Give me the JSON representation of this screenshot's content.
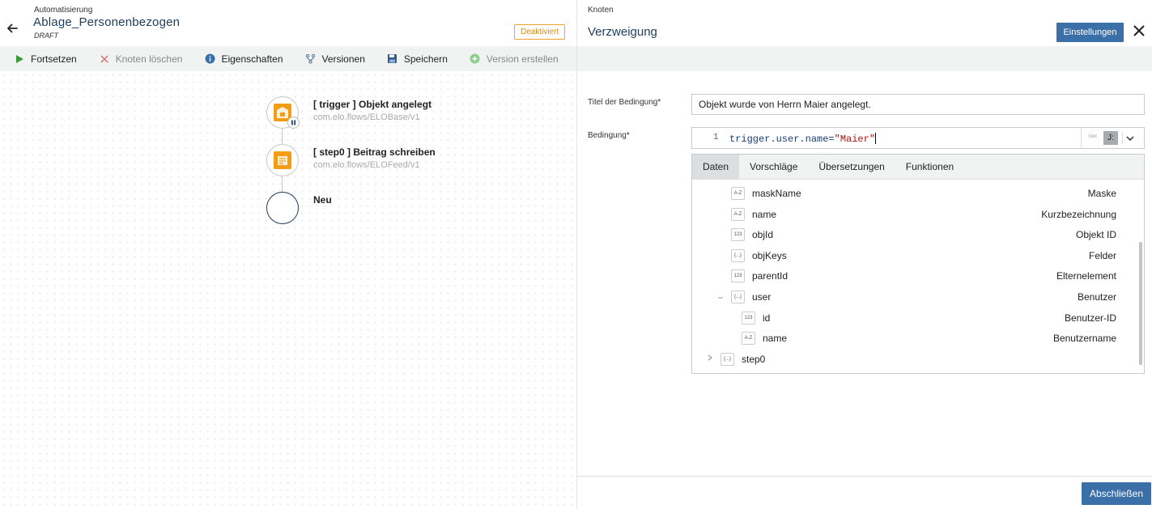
{
  "workflow": {
    "breadcrumb": "Automatisierung",
    "title": "Ablage_Personenbezogen",
    "status": "DRAFT",
    "state_badge": "Deaktiviert"
  },
  "toolbar": {
    "continue": "Fortsetzen",
    "delete_node": "Knoten löschen",
    "properties": "Eigenschaften",
    "versions": "Versionen",
    "save": "Speichern",
    "create_version": "Version erstellen"
  },
  "flow": {
    "nodes": [
      {
        "title": "[ trigger ] Objekt angelegt",
        "subtitle": "com.elo.flows/ELOBase/v1"
      },
      {
        "title": "[ step0 ] Beitrag schreiben",
        "subtitle": "com.elo.flows/ELOFeed/v1"
      },
      {
        "title": "Neu",
        "subtitle": ""
      }
    ]
  },
  "panel": {
    "breadcrumb": "Knoten",
    "title": "Verzweigung",
    "settings_button": "Einstellungen",
    "condition_title_label": "Titel der Bedingung*",
    "condition_title_value": "Objekt wurde von Herrn Maier angelegt.",
    "condition_label": "Bedingung*",
    "editor": {
      "line_number": "1",
      "code_prefix": "trigger.user.name=",
      "code_string": "\"Maier\"",
      "tool_label": "tool",
      "format_button": "J:"
    },
    "tabs": [
      "Daten",
      "Vorschläge",
      "Übersetzungen",
      "Funktionen"
    ],
    "tree": [
      {
        "type": "A-Z",
        "name": "maskName",
        "desc": "Maske"
      },
      {
        "type": "A-Z",
        "name": "name",
        "desc": "Kurzbezeichnung"
      },
      {
        "type": "123",
        "name": "objId",
        "desc": "Objekt ID"
      },
      {
        "type": "{...}",
        "name": "objKeys",
        "desc": "Felder"
      },
      {
        "type": "123",
        "name": "parentId",
        "desc": "Elternelement"
      },
      {
        "type": "{...}",
        "name": "user",
        "desc": "Benutzer"
      },
      {
        "type": "123",
        "name": "id",
        "desc": "Benutzer-ID"
      },
      {
        "type": "A-Z",
        "name": "name",
        "desc": "Benutzername"
      },
      {
        "type": "{...}",
        "name": "step0",
        "desc": ""
      }
    ],
    "finish_button": "Abschließen"
  },
  "colors": {
    "accent": "#3a6fa8",
    "title_blue": "#1c3d5e",
    "node_orange": "#f29d13",
    "badge_orange": "#e08a10"
  }
}
